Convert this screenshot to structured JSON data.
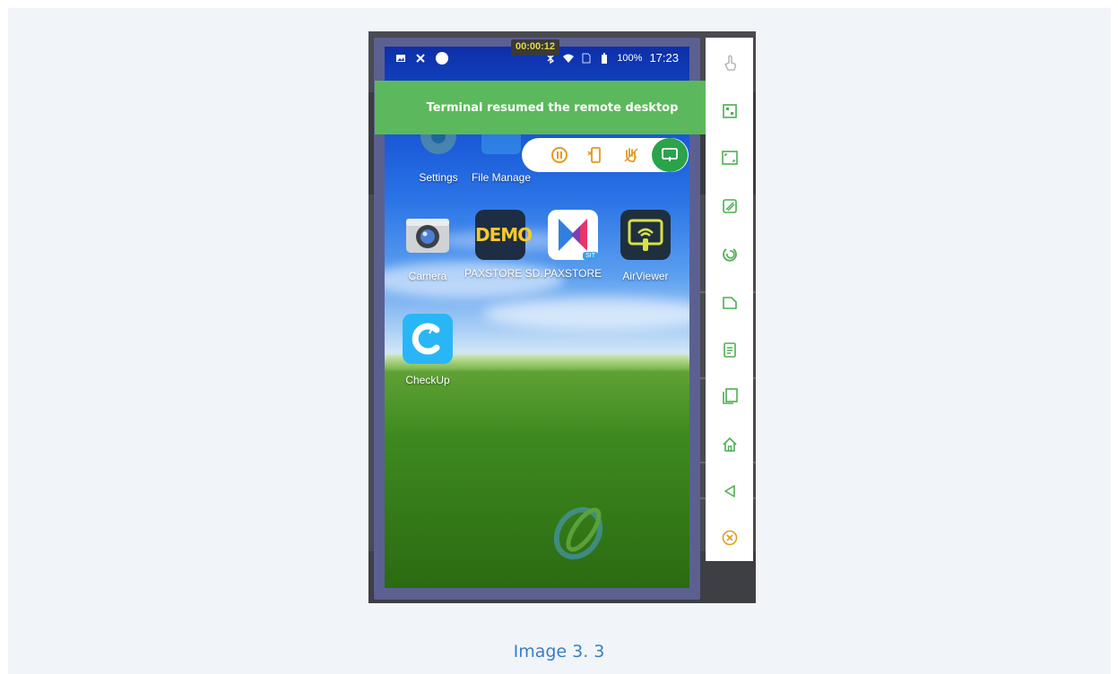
{
  "figure": {
    "caption": "Image 3. 3"
  },
  "session": {
    "timer": "00:00:12"
  },
  "toast": {
    "message": "Terminal resumed the remote desktop"
  },
  "status_bar": {
    "battery": "100%",
    "time": "17:23",
    "left_icons": [
      "image-icon",
      "close-x-icon",
      "circle-icon"
    ],
    "right_icons": [
      "bluetooth-icon",
      "wifi-icon",
      "no-sim-icon",
      "battery-icon"
    ]
  },
  "home_screen": {
    "apps": [
      {
        "label": "Settings",
        "icon": "settings-icon"
      },
      {
        "label": "File Manage",
        "icon": "file-manager-icon"
      },
      {
        "label": "Camera",
        "icon": "camera-icon"
      },
      {
        "label": "PAXSTORE SD..",
        "icon": "demo-icon",
        "icon_text": "DEMO"
      },
      {
        "label": "PAXSTORE",
        "icon": "paxstore-icon",
        "badge": "SIT"
      },
      {
        "label": "AirViewer",
        "icon": "airviewer-icon"
      },
      {
        "label": "CheckUp",
        "icon": "checkup-icon"
      }
    ]
  },
  "floating_toolbar": {
    "buttons": [
      "pause-icon",
      "phone-switch-icon",
      "hand-stop-icon",
      "screen-share-icon"
    ]
  },
  "side_toolbar": {
    "buttons": [
      "touch-icon",
      "qr-code-icon",
      "fullscreen-icon",
      "edit-icon",
      "record-icon",
      "file-icon",
      "clipboard-icon",
      "copy-icon",
      "home-icon",
      "back-icon",
      "close-circle-icon"
    ]
  },
  "colors": {
    "toast_bg": "#5cb85c",
    "caption": "#3a7dc4",
    "accent_green": "#2aa34a",
    "floating_icon": "#e39a1c"
  }
}
